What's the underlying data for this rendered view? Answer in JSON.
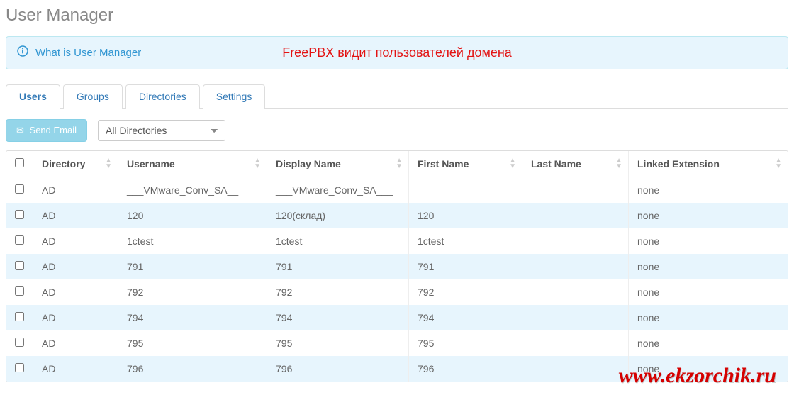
{
  "page_title": "User Manager",
  "info": {
    "link_text": "What is User Manager",
    "annotation": "FreePBX видит пользователей домена"
  },
  "tabs": [
    {
      "label": "Users",
      "active": true
    },
    {
      "label": "Groups",
      "active": false
    },
    {
      "label": "Directories",
      "active": false
    },
    {
      "label": "Settings",
      "active": false
    }
  ],
  "controls": {
    "send_email_label": "Send Email",
    "directory_filter": "All Directories"
  },
  "columns": [
    "Directory",
    "Username",
    "Display Name",
    "First Name",
    "Last Name",
    "Linked Extension"
  ],
  "rows": [
    {
      "directory": "AD",
      "username": "___VMware_Conv_SA__",
      "display_name": "___VMware_Conv_SA___",
      "first_name": "",
      "last_name": "",
      "linked_extension": "none"
    },
    {
      "directory": "AD",
      "username": "120",
      "display_name": "120(склад)",
      "first_name": "120",
      "last_name": "",
      "linked_extension": "none"
    },
    {
      "directory": "AD",
      "username": "1ctest",
      "display_name": "1ctest",
      "first_name": "1ctest",
      "last_name": "",
      "linked_extension": "none"
    },
    {
      "directory": "AD",
      "username": "791",
      "display_name": "791",
      "first_name": "791",
      "last_name": "",
      "linked_extension": "none"
    },
    {
      "directory": "AD",
      "username": "792",
      "display_name": "792",
      "first_name": "792",
      "last_name": "",
      "linked_extension": "none"
    },
    {
      "directory": "AD",
      "username": "794",
      "display_name": "794",
      "first_name": "794",
      "last_name": "",
      "linked_extension": "none"
    },
    {
      "directory": "AD",
      "username": "795",
      "display_name": "795",
      "first_name": "795",
      "last_name": "",
      "linked_extension": "none"
    },
    {
      "directory": "AD",
      "username": "796",
      "display_name": "796",
      "first_name": "796",
      "last_name": "",
      "linked_extension": "none"
    }
  ],
  "watermark": "www.ekzorchik.ru"
}
